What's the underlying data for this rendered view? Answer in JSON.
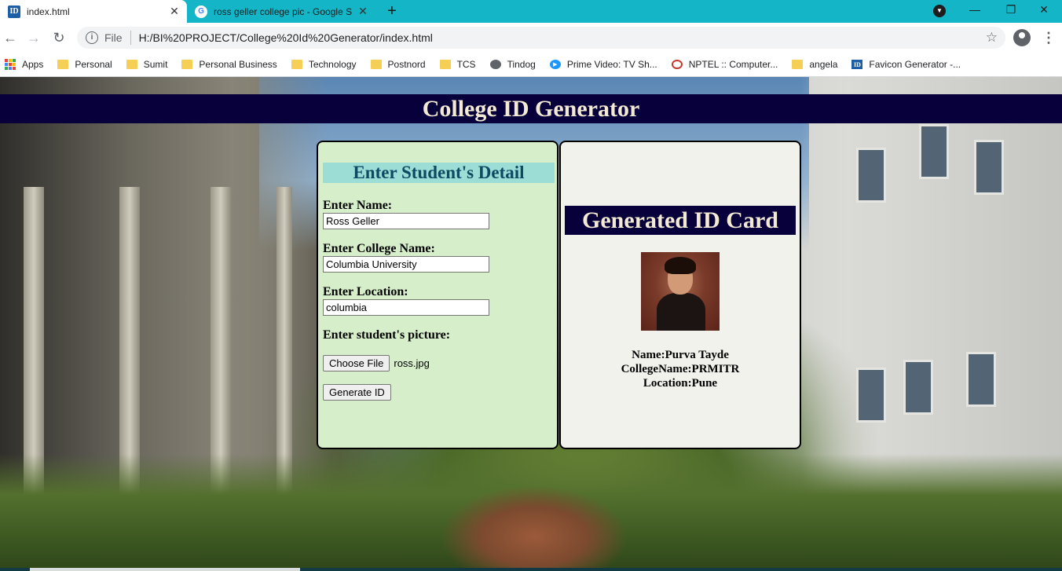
{
  "browser": {
    "tabs": [
      {
        "title": "index.html",
        "favicon": "ID",
        "active": true
      },
      {
        "title": "ross geller college pic - Google S",
        "favicon": "G",
        "active": false
      }
    ],
    "new_tab": "+",
    "window_controls": {
      "minimize": "—",
      "restore": "❐",
      "close": "✕"
    },
    "address": {
      "scheme": "File",
      "url": "H:/BI%20PROJECT/College%20Id%20Generator/index.html"
    },
    "bookmarks": [
      {
        "label": "Apps",
        "icon": "apps-grid-icon"
      },
      {
        "label": "Personal",
        "icon": "folder-icon"
      },
      {
        "label": "Sumit",
        "icon": "folder-icon"
      },
      {
        "label": "Personal Business",
        "icon": "folder-icon"
      },
      {
        "label": "Technology",
        "icon": "folder-icon"
      },
      {
        "label": "Postnord",
        "icon": "folder-icon"
      },
      {
        "label": "TCS",
        "icon": "folder-icon"
      },
      {
        "label": "Tindog",
        "icon": "globe-icon"
      },
      {
        "label": "Prime Video: TV Sh...",
        "icon": "prime-video-icon"
      },
      {
        "label": "NPTEL :: Computer...",
        "icon": "nptel-icon"
      },
      {
        "label": "angela",
        "icon": "folder-icon"
      },
      {
        "label": "Favicon Generator -...",
        "icon": "id-favicon-icon"
      }
    ]
  },
  "page": {
    "banner_title": "College ID Generator",
    "form": {
      "heading": "Enter Student's Detail",
      "name_label": "Enter Name:",
      "name_value": "Ross Geller",
      "college_label": "Enter College Name:",
      "college_value": "Columbia University",
      "location_label": "Enter Location:",
      "location_value": "columbia",
      "picture_label": "Enter student's picture:",
      "choose_file_label": "Choose File",
      "file_name": "ross.jpg",
      "generate_label": "Generate ID"
    },
    "card": {
      "heading": "Generated ID Card",
      "name_line": "Name:Purva Tayde",
      "college_line": "CollegeName:PRMITR",
      "location_line": "Location:Pune"
    }
  },
  "colors": {
    "tab_strip": "#13b5c6",
    "banner_bg": "#08003a",
    "banner_text": "#f3ead3",
    "form_panel_bg": "#d6efca",
    "form_heading_bg": "#9cddd6",
    "form_heading_text": "#0f4a63",
    "card_panel_bg": "#f2f2ec"
  }
}
